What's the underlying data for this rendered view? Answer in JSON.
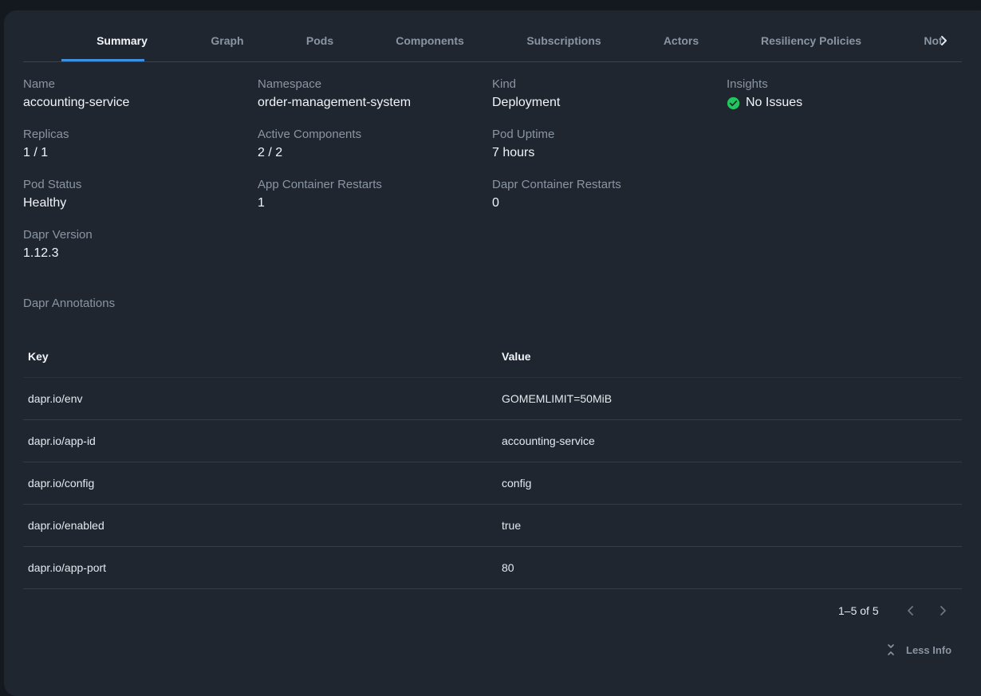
{
  "tabs": {
    "items": [
      {
        "label": "Summary",
        "active": true
      },
      {
        "label": "Graph",
        "active": false
      },
      {
        "label": "Pods",
        "active": false
      },
      {
        "label": "Components",
        "active": false
      },
      {
        "label": "Subscriptions",
        "active": false
      },
      {
        "label": "Actors",
        "active": false
      },
      {
        "label": "Resiliency Policies",
        "active": false
      },
      {
        "label": "Not",
        "active": false
      }
    ],
    "scroll_icon": "chevron-right-icon"
  },
  "summary": {
    "name": {
      "label": "Name",
      "value": "accounting-service"
    },
    "namespace": {
      "label": "Namespace",
      "value": "order-management-system"
    },
    "kind": {
      "label": "Kind",
      "value": "Deployment"
    },
    "insights": {
      "label": "Insights",
      "value": "No Issues",
      "icon": "check-circle-icon",
      "status_color": "#22c55e"
    },
    "replicas": {
      "label": "Replicas",
      "value": "1 / 1"
    },
    "active_components": {
      "label": "Active Components",
      "value": "2 / 2"
    },
    "pod_uptime": {
      "label": "Pod Uptime",
      "value": "7 hours"
    },
    "pod_status": {
      "label": "Pod Status",
      "value": "Healthy"
    },
    "app_container_restarts": {
      "label": "App Container Restarts",
      "value": "1"
    },
    "dapr_container_restarts": {
      "label": "Dapr Container Restarts",
      "value": "0"
    },
    "dapr_version": {
      "label": "Dapr Version",
      "value": "1.12.3"
    }
  },
  "annotations": {
    "title": "Dapr Annotations",
    "columns": {
      "key": "Key",
      "value": "Value"
    },
    "rows": [
      {
        "key": "dapr.io/env",
        "value": "GOMEMLIMIT=50MiB"
      },
      {
        "key": "dapr.io/app-id",
        "value": "accounting-service"
      },
      {
        "key": "dapr.io/config",
        "value": "config"
      },
      {
        "key": "dapr.io/enabled",
        "value": "true"
      },
      {
        "key": "dapr.io/app-port",
        "value": "80"
      }
    ],
    "pagination": {
      "range": "1–5 of 5",
      "prev_icon": "chevron-left-icon",
      "next_icon": "chevron-right-icon"
    }
  },
  "footer": {
    "less_info_label": "Less Info",
    "less_info_icon": "collapse-icon"
  },
  "colors": {
    "accent": "#3d8fe0",
    "background": "#1f2630",
    "success": "#22c55e"
  }
}
